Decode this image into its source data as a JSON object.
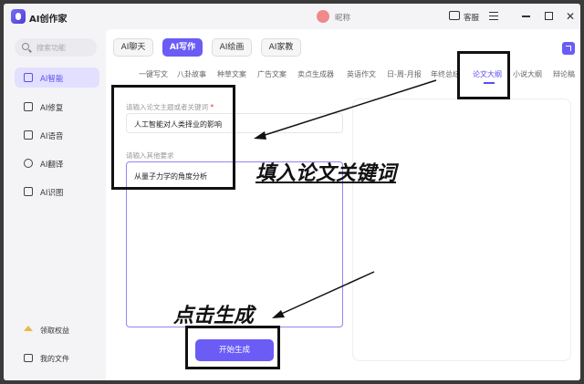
{
  "window": {
    "app_name": "AI创作家",
    "nickname": "昵称",
    "service_label": "客服"
  },
  "sidebar": {
    "search_placeholder": "搜索功能",
    "items": [
      {
        "label": "AI智能",
        "active": true
      },
      {
        "label": "AI修复",
        "active": false
      },
      {
        "label": "AI语音",
        "active": false
      },
      {
        "label": "AI翻译",
        "active": false
      },
      {
        "label": "AI识图",
        "active": false
      }
    ],
    "footer": [
      {
        "label": "领取权益"
      },
      {
        "label": "我的文件"
      }
    ]
  },
  "top_tabs": [
    {
      "label": "AI聊天",
      "active": false
    },
    {
      "label": "AI写作",
      "active": true
    },
    {
      "label": "AI绘画",
      "active": false
    },
    {
      "label": "AI家教",
      "active": false
    }
  ],
  "sub_tabs": [
    "一键写文",
    "八卦故事",
    "种草文案",
    "广告文案",
    "卖点生成器",
    "英语作文",
    "日-周-月报",
    "年终总结",
    "论文大纲",
    "小说大纲",
    "辩论稿"
  ],
  "active_sub_tab": "论文大纲",
  "form": {
    "keyword_label": "请输入论文主题或者关键词",
    "keyword_required_mark": "*",
    "keyword_value": "人工智能对人类择业的影响",
    "other_label": "请输入其他要求",
    "other_value": "从量子力学的角度分析",
    "generate_button": "开始生成"
  },
  "annotations": {
    "fill_keywords": "填入论文关键词",
    "click_generate": "点击生成"
  },
  "colors": {
    "accent": "#6a5cf5",
    "accent_light": "#e2dfff"
  }
}
